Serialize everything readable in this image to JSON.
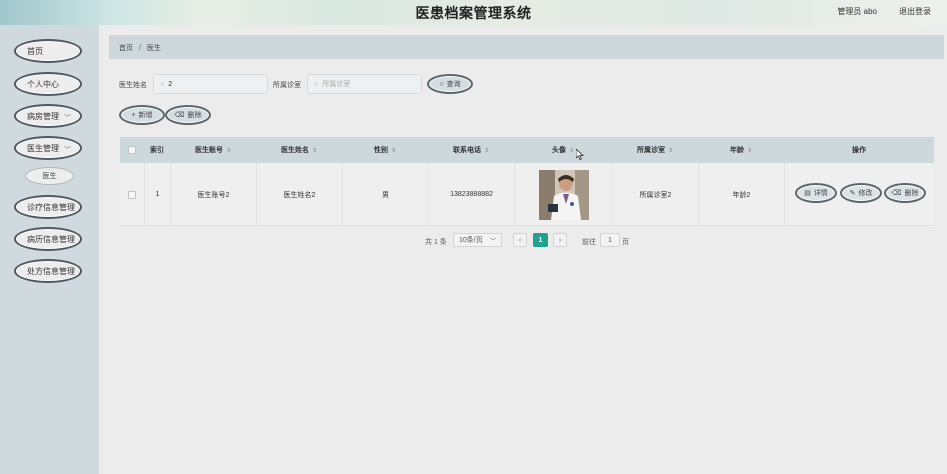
{
  "header": {
    "title": "医患档案管理系统",
    "user": "管理员 abo",
    "logout": "退出登录"
  },
  "sidebar": {
    "items": [
      {
        "label": "首页"
      },
      {
        "label": "个人中心"
      },
      {
        "label": "病房管理"
      },
      {
        "label": "医生管理"
      },
      {
        "label": "诊疗信息管理"
      },
      {
        "label": "病历信息管理"
      },
      {
        "label": "处方信息管理"
      }
    ],
    "sub_items": [
      {
        "label": "医生"
      }
    ]
  },
  "breadcrumb": {
    "home": "首页",
    "separator": "/",
    "current": "医生"
  },
  "search": {
    "name_label": "医生姓名",
    "name_value": "2",
    "dept_label": "所属诊室",
    "dept_placeholder": "所属诊室",
    "query_button": "查询"
  },
  "actions": {
    "add": "新增",
    "delete": "删除"
  },
  "table": {
    "headers": [
      "索引",
      "医生账号",
      "医生姓名",
      "性别",
      "联系电话",
      "头像",
      "所属诊室",
      "年龄",
      "操作"
    ],
    "rows": [
      {
        "index": "1",
        "account": "医生账号2",
        "name": "医生姓名2",
        "gender": "男",
        "phone": "13823888882",
        "dept": "所属诊室2",
        "age": "年龄2",
        "btn_detail": "详情",
        "btn_edit": "修改",
        "btn_delete": "删除"
      }
    ]
  },
  "pagination": {
    "total": "共 1 条",
    "page_size": "10条/页",
    "current_page": "1",
    "goto_label": "前往",
    "goto_value": "1",
    "page_unit": "页"
  },
  "colors": {
    "accent": "#22a190",
    "sidebar": "#cfd9de",
    "header_bar": "#cdd8dd"
  }
}
